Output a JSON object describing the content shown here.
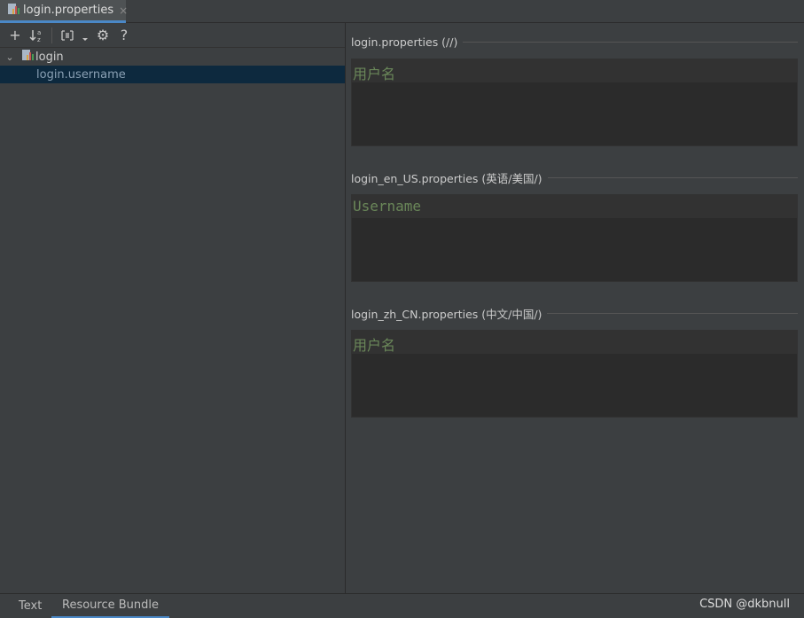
{
  "tab": {
    "label": "login.properties",
    "close": "×"
  },
  "toolbar": {
    "add": "+",
    "sort": "↓",
    "group": "☰",
    "settings": "⚙",
    "help": "?"
  },
  "tree": {
    "root_label": "login",
    "expand_arrow": "⌄",
    "child_label": "login.username"
  },
  "sections": [
    {
      "title": "login.properties (//)",
      "value": "用户名"
    },
    {
      "title": "login_en_US.properties (英语/美国/)",
      "value": "Username"
    },
    {
      "title": "login_zh_CN.properties (中文/中国/)",
      "value": "用户名"
    }
  ],
  "bottom_tabs": {
    "text": "Text",
    "resource_bundle": "Resource Bundle"
  },
  "watermark": "CSDN @dkbnull",
  "colors": {
    "accent": "#4a88c7",
    "value_green": "#6a8759",
    "selection": "#0d293e"
  }
}
